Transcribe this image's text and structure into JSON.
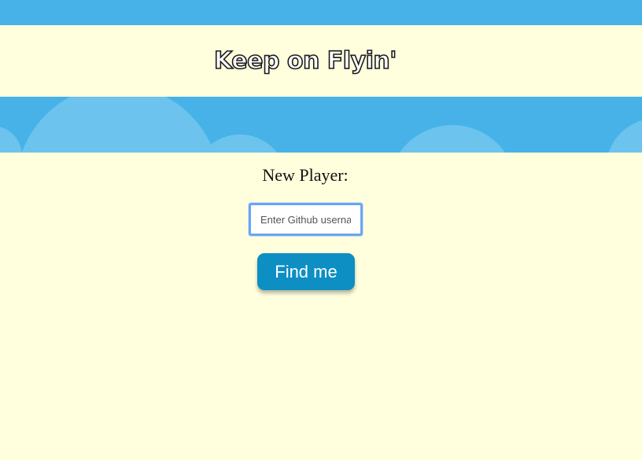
{
  "header": {
    "title": "Keep on Flyin'"
  },
  "form": {
    "label": "New Player:",
    "username_placeholder": "Enter Github username",
    "username_value": "",
    "submit_label": "Find me"
  },
  "colors": {
    "sky": "#46b2e8",
    "cloud": "#6cc3ee",
    "background": "#ffffdd",
    "button": "#0d8fc3",
    "input_focus": "#6aa6f0"
  }
}
